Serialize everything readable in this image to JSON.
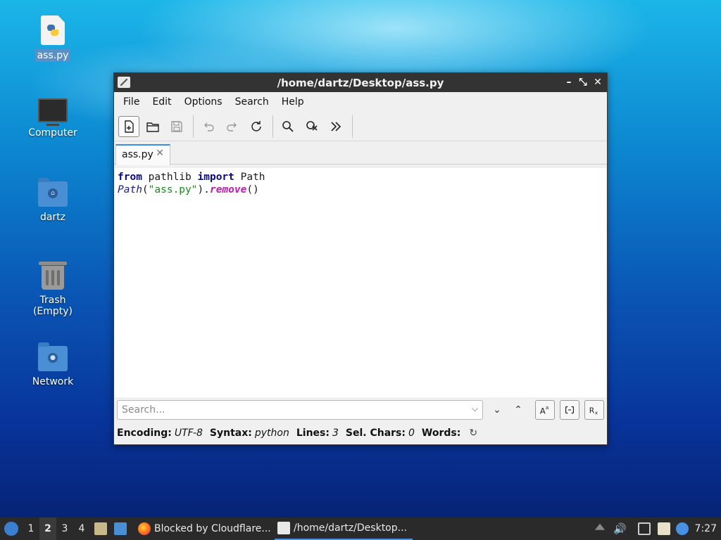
{
  "desktop": {
    "icons": [
      {
        "label": "ass.py"
      },
      {
        "label": "Computer"
      },
      {
        "label": "dartz"
      },
      {
        "label": "Trash (Empty)"
      },
      {
        "label": "Network"
      }
    ]
  },
  "window": {
    "title": "/home/dartz/Desktop/ass.py",
    "controls": {
      "minimize": "–",
      "maximize": "⤡",
      "close": "✕"
    }
  },
  "menu": [
    "File",
    "Edit",
    "Options",
    "Search",
    "Help"
  ],
  "tab": {
    "label": "ass.py",
    "close": "✕"
  },
  "code": {
    "line1": {
      "kw1": "from",
      "mod": " pathlib ",
      "kw2": "import",
      "name": " Path"
    },
    "line2": {
      "cls": "Path",
      "open": "(",
      "str": "\"ass.py\"",
      "dot": ").",
      "fn": "remove",
      "end": "()"
    }
  },
  "search": {
    "placeholder": "Search..."
  },
  "status": {
    "encoding_label": "Encoding:",
    "encoding": "UTF-8",
    "syntax_label": "Syntax:",
    "syntax": "python",
    "lines_label": "Lines:",
    "lines": "3",
    "sel_label": "Sel. Chars:",
    "sel": "0",
    "words_label": "Words:"
  },
  "taskbar": {
    "workspaces": [
      "1",
      "2",
      "3",
      "4"
    ],
    "current_workspace": "2",
    "tasks": [
      {
        "label": "Blocked by Cloudflare..."
      },
      {
        "label": "/home/dartz/Desktop..."
      }
    ],
    "clock": "7:27"
  }
}
